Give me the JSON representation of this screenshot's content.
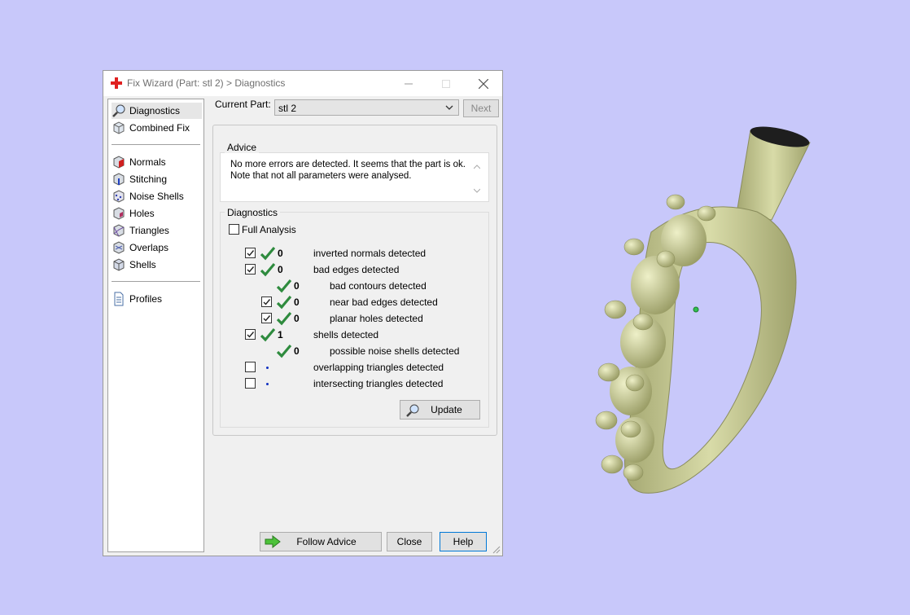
{
  "window": {
    "title": "Fix Wizard (Part: stl 2) > Diagnostics"
  },
  "nav": {
    "items": [
      {
        "label": "Diagnostics",
        "icon": "magnifier-icon"
      },
      {
        "label": "Combined Fix",
        "icon": "cube-icon"
      },
      {
        "label": "Normals",
        "icon": "normals-cube-icon"
      },
      {
        "label": "Stitching",
        "icon": "stitching-cube-icon"
      },
      {
        "label": "Noise Shells",
        "icon": "noise-shells-icon"
      },
      {
        "label": "Holes",
        "icon": "holes-cube-icon"
      },
      {
        "label": "Triangles",
        "icon": "triangles-cube-icon"
      },
      {
        "label": "Overlaps",
        "icon": "overlaps-cube-icon"
      },
      {
        "label": "Shells",
        "icon": "shells-cube-icon"
      },
      {
        "label": "Profiles",
        "icon": "document-icon"
      }
    ]
  },
  "part": {
    "label": "Current Part:",
    "value": "stl 2",
    "next": "Next"
  },
  "advice": {
    "title": "Advice",
    "text": "No more errors are detected. It seems that the part is ok. Note that not all parameters were analysed."
  },
  "diagnostics": {
    "title": "Diagnostics",
    "full_analysis": "Full Analysis",
    "rows": [
      {
        "count": "0",
        "label": "inverted normals detected"
      },
      {
        "count": "0",
        "label": "bad edges detected"
      },
      {
        "count": "0",
        "label": "bad contours detected"
      },
      {
        "count": "0",
        "label": "near bad edges detected"
      },
      {
        "count": "0",
        "label": "planar holes detected"
      },
      {
        "count": "1",
        "label": "shells detected"
      },
      {
        "count": "0",
        "label": "possible noise shells detected"
      },
      {
        "count": "",
        "label": "overlapping triangles detected"
      },
      {
        "count": "",
        "label": "intersecting triangles detected"
      }
    ],
    "update": "Update"
  },
  "buttons": {
    "follow": "Follow Advice",
    "close": "Close",
    "help": "Help"
  },
  "colors": {
    "background": "#c8c8fa",
    "model": "#c8cc94",
    "check": "#2e8b3e",
    "close_red": "#e02020"
  }
}
